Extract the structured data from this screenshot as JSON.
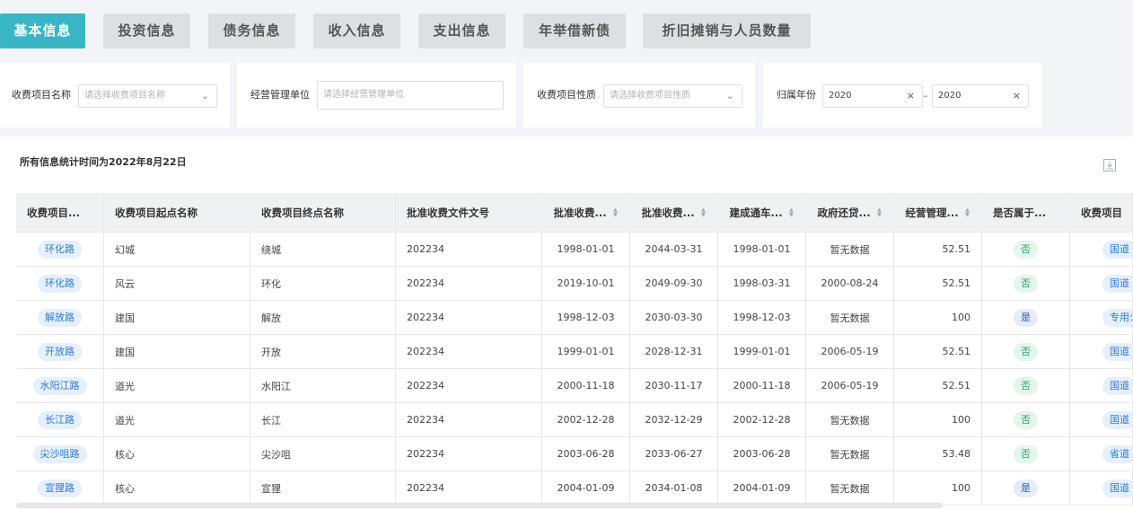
{
  "tabs": [
    {
      "label": "基本信息",
      "active": true
    },
    {
      "label": "投资信息",
      "active": false
    },
    {
      "label": "债务信息",
      "active": false
    },
    {
      "label": "收入信息",
      "active": false
    },
    {
      "label": "支出信息",
      "active": false
    },
    {
      "label": "年举借新债",
      "active": false
    },
    {
      "label": "折旧摊销与人员数量",
      "active": false
    }
  ],
  "filters": {
    "project_name": {
      "label": "收费项目名称",
      "placeholder": "请选择收费项目名称"
    },
    "management_unit": {
      "label": "经营管理单位",
      "placeholder": "请选择经营管理单位"
    },
    "project_nature": {
      "label": "收费项目性质",
      "placeholder": "请选择收费项目性质"
    },
    "year": {
      "label": "归属年份",
      "from": "2020",
      "separator": "–",
      "to": "2020"
    }
  },
  "stat_time": "所有信息统计时间为2022年8月22日",
  "table": {
    "headers": [
      "收费项目...",
      "收费项目起点名称",
      "收费项目终点名称",
      "批准收费文件文号",
      "批准收费...",
      "批准收费...",
      "建成通车...",
      "政府还贷...",
      "经营管理...",
      "是否属于...",
      "收费项目"
    ],
    "rows": [
      {
        "name": "环化路",
        "start": "幻城",
        "end": "绕城",
        "doc": "202234",
        "d1": "1998-01-01",
        "d2": "2044-03-31",
        "d3": "1998-01-01",
        "d4": "暂无数据",
        "num": "52.51",
        "flag": "否",
        "type": "国道"
      },
      {
        "name": "环化路",
        "start": "风云",
        "end": "环化",
        "doc": "202234",
        "d1": "2019-10-01",
        "d2": "2049-09-30",
        "d3": "1998-03-31",
        "d4": "2000-08-24",
        "num": "52.51",
        "flag": "否",
        "type": "国道"
      },
      {
        "name": "解放路",
        "start": "建国",
        "end": "解放",
        "doc": "202234",
        "d1": "1998-12-03",
        "d2": "2030-03-30",
        "d3": "1998-12-03",
        "d4": "暂无数据",
        "num": "100",
        "flag": "是",
        "type": "专用公"
      },
      {
        "name": "开放路",
        "start": "建国",
        "end": "开放",
        "doc": "202234",
        "d1": "1999-01-01",
        "d2": "2028-12-31",
        "d3": "1999-01-01",
        "d4": "2006-05-19",
        "num": "52.51",
        "flag": "否",
        "type": "国道"
      },
      {
        "name": "水阳江路",
        "start": "道光",
        "end": "水阳江",
        "doc": "202234",
        "d1": "2000-11-18",
        "d2": "2030-11-17",
        "d3": "2000-11-18",
        "d4": "2006-05-19",
        "num": "52.51",
        "flag": "否",
        "type": "国道"
      },
      {
        "name": "长江路",
        "start": "道光",
        "end": "长江",
        "doc": "202234",
        "d1": "2002-12-28",
        "d2": "2032-12-29",
        "d3": "2002-12-28",
        "d4": "暂无数据",
        "num": "100",
        "flag": "否",
        "type": "国道"
      },
      {
        "name": "尖沙咀路",
        "start": "核心",
        "end": "尖沙咀",
        "doc": "202234",
        "d1": "2003-06-28",
        "d2": "2033-06-27",
        "d3": "2003-06-28",
        "d4": "暂无数据",
        "num": "53.48",
        "flag": "否",
        "type": "省道"
      },
      {
        "name": "宣狸路",
        "start": "核心",
        "end": "宣狸",
        "doc": "202234",
        "d1": "2004-01-09",
        "d2": "2034-01-08",
        "d3": "2004-01-09",
        "d4": "暂无数据",
        "num": "100",
        "flag": "是",
        "type": "国道"
      }
    ]
  },
  "colors": {
    "accent": "#3ab5c6",
    "tag_blue": "#2f7cd3",
    "tag_green": "#2fa565",
    "tag_navy": "#2f5ca8"
  }
}
